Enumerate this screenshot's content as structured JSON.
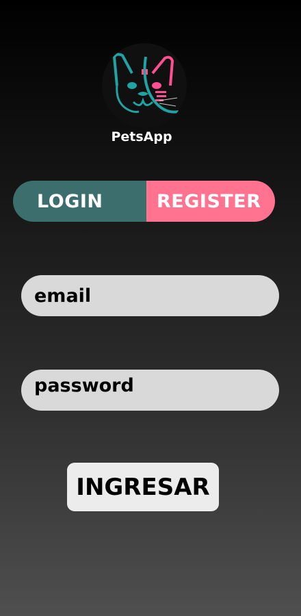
{
  "app": {
    "name": "PetsApp",
    "logo_icon": "french-bulldog-logo-icon"
  },
  "toggle": {
    "login_label": "LOGIN",
    "register_label": "REGISTER",
    "active": "login"
  },
  "form": {
    "email_placeholder": "email",
    "email_value": "",
    "password_placeholder": "password",
    "password_value": "",
    "submit_label": "INGRESAR"
  },
  "colors": {
    "login_tab": "#3d6e6e",
    "register_tab": "#ff7391",
    "field_bg": "#d9d9d9",
    "button_bg": "#ececec",
    "logo_teal": "#1fa3a3",
    "logo_pink": "#ff4f93"
  }
}
